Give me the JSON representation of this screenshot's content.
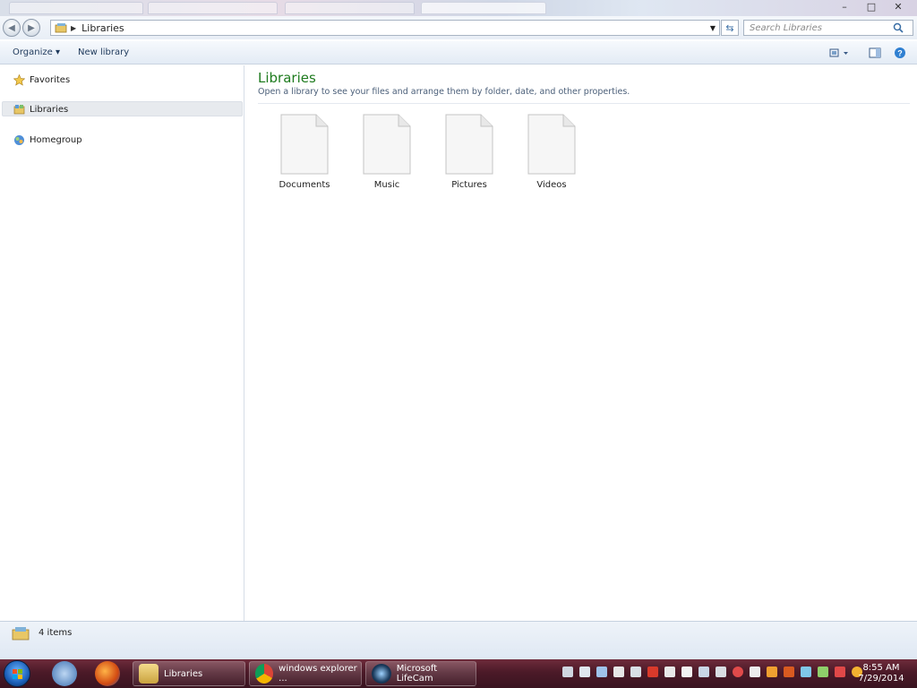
{
  "window": {
    "controls": {
      "minimize": "–",
      "maximize": "□",
      "close": "✕"
    }
  },
  "address_bar": {
    "path": "Libraries",
    "search_placeholder": "Search Libraries"
  },
  "toolbar": {
    "organize": "Organize ▾",
    "new_library": "New library"
  },
  "nav": {
    "favorites": "Favorites",
    "libraries": "Libraries",
    "homegroup": "Homegroup"
  },
  "content": {
    "title": "Libraries",
    "subtitle": "Open a library to see your files and arrange them by folder, date, and other properties.",
    "items": [
      {
        "label": "Documents"
      },
      {
        "label": "Music"
      },
      {
        "label": "Pictures"
      },
      {
        "label": "Videos"
      }
    ]
  },
  "status": {
    "item_count": "4 items"
  },
  "taskbar": {
    "buttons": [
      {
        "label": "Libraries"
      },
      {
        "label": "windows explorer ..."
      },
      {
        "label": "Microsoft LifeCam"
      }
    ],
    "clock_time": "8:55 AM",
    "clock_date": "7/29/2014"
  },
  "colors": {
    "title_green": "#1e7b1e",
    "taskbar": "#4b1a28"
  }
}
